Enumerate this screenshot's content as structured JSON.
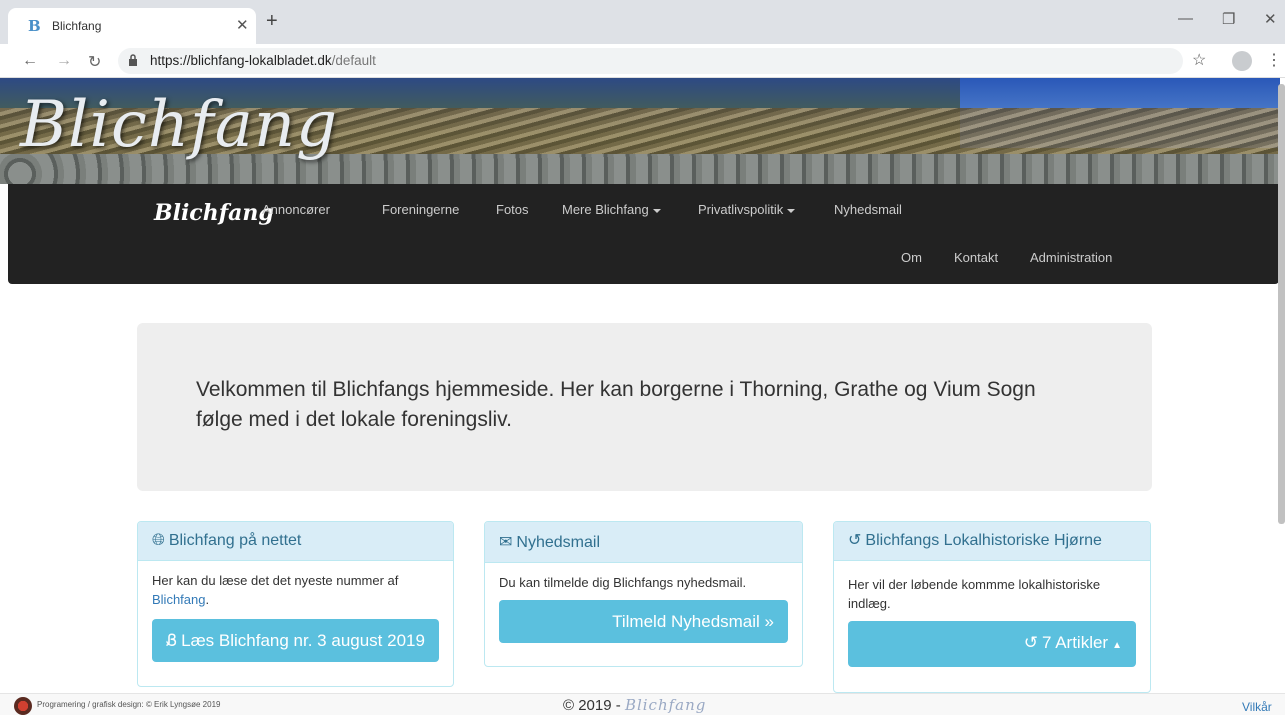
{
  "browser": {
    "tab_title": "Blichfang",
    "favicon": "B",
    "url_host": "https://blichfang-lokalbladet.dk",
    "url_path": "/default"
  },
  "banner": {
    "logo_text": "Blichfang"
  },
  "nav": {
    "brand": "Blichfang",
    "row1": [
      "Annoncører",
      "Foreningerne",
      "Fotos",
      "Mere Blichfang",
      "Privatlivspolitik",
      "Nyhedsmail"
    ],
    "row2": [
      "Om",
      "Kontakt",
      "Administration"
    ]
  },
  "jumbotron": {
    "text": "Velkommen til Blichfangs hjemmeside. Her kan borgerne i Thorning, Grathe og Vium Sogn følge med i det lokale foreningsliv."
  },
  "panels": [
    {
      "icon": "globe-icon",
      "title": "Blichfang på nettet",
      "body": "Her kan du læse det det nyeste nummer af",
      "link": "Blichfang",
      "after_link": ".",
      "button": "Læs Blichfang nr. 3 august 2019"
    },
    {
      "icon": "envelope-icon",
      "title": "Nyhedsmail",
      "body": "Du kan tilmelde dig Blichfangs nyhedsmail.",
      "button": "Tilmeld Nyhedsmail »"
    },
    {
      "icon": "history-icon",
      "title": "Blichfangs Lokalhistoriske Hjørne",
      "body": "Her vil der løbende kommme lokalhistoriske indlæg.",
      "button": "7 Artikler"
    }
  ],
  "footer": {
    "credit": "Programering / grafisk design: © Erik Lyngsøe 2019",
    "copyright": "© 2019 -",
    "copyright_brand": "Blichfang",
    "terms": "Vilkår"
  },
  "colors": {
    "nav_bg": "#222222",
    "panel_head": "#d9edf7",
    "button_info": "#5bc0de",
    "link": "#337ab7"
  }
}
